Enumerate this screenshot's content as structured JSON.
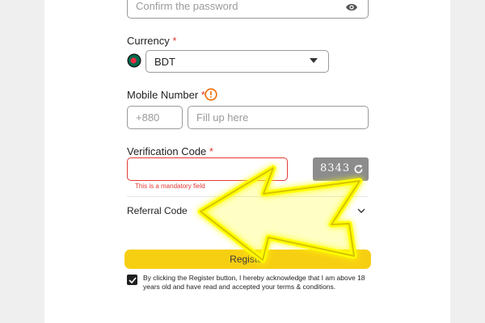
{
  "confirm_password": {
    "placeholder": "Confirm the password"
  },
  "currency": {
    "label": "Currency",
    "required_mark": "*",
    "selected": "BDT"
  },
  "mobile": {
    "label": "Mobile Number",
    "required_mark": "*",
    "country_code": "+880",
    "placeholder": "Fill up here"
  },
  "verification": {
    "label": "Verification Code",
    "required_mark": "*",
    "error": "This is a mandatory field",
    "captcha": "8343"
  },
  "referral": {
    "label": "Referral Code"
  },
  "register": {
    "label": "Register"
  },
  "terms": {
    "text": "By clicking the Register button, I hereby acknowledge that I am above 18 years old and have read and accepted your terms & conditions.",
    "checked": true
  },
  "colors": {
    "accent": "#f7cf12",
    "error": "#e53935",
    "warning": "#ef6c00",
    "arrow": "#ffff00"
  }
}
